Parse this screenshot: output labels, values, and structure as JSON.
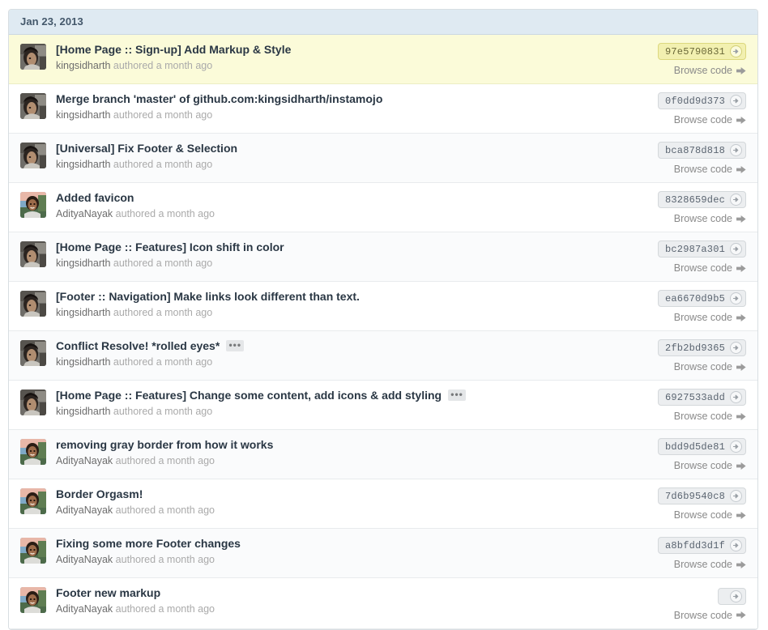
{
  "panel": {
    "date_header": "Jan 23, 2013"
  },
  "labels": {
    "browse_code": "Browse code",
    "authored_suffix": "authored a month ago",
    "expand_ellipsis": "•••"
  },
  "colors": {
    "header_bg": "#dfeaf2",
    "header_text": "#44586b",
    "row_bg": "#fafbfc",
    "row_alt_bg": "#ffffff",
    "highlight_bg": "#fbfbd9",
    "title_text": "#2a3744",
    "meta_text": "#aaaaaa",
    "sha_bg": "#eceef0",
    "sha_text": "#5a6470",
    "link_hover": "#4183c4",
    "border": "#d8dee2"
  },
  "commits": [
    {
      "title": "[Home Page :: Sign-up] Add Markup & Style",
      "author": "kingsidharth",
      "authored": "authored a month ago",
      "sha": "97e5790831",
      "browse": "Browse code",
      "has_expand": false,
      "highlight": true,
      "avatar": "kingsidharth-avatar"
    },
    {
      "title": "Merge branch 'master' of github.com:kingsidharth/instamojo",
      "author": "kingsidharth",
      "authored": "authored a month ago",
      "sha": "0f0dd9d373",
      "browse": "Browse code",
      "has_expand": false,
      "highlight": false,
      "avatar": "kingsidharth-avatar"
    },
    {
      "title": "[Universal] Fix Footer & Selection",
      "author": "kingsidharth",
      "authored": "authored a month ago",
      "sha": "bca878d818",
      "browse": "Browse code",
      "has_expand": false,
      "highlight": false,
      "avatar": "kingsidharth-avatar"
    },
    {
      "title": "Added favicon",
      "author": "AdityaNayak",
      "authored": "authored a month ago",
      "sha": "8328659dec",
      "browse": "Browse code",
      "has_expand": false,
      "highlight": false,
      "avatar": "adityanayak-avatar"
    },
    {
      "title": "[Home Page :: Features] Icon shift in color",
      "author": "kingsidharth",
      "authored": "authored a month ago",
      "sha": "bc2987a301",
      "browse": "Browse code",
      "has_expand": false,
      "highlight": false,
      "avatar": "kingsidharth-avatar"
    },
    {
      "title": "[Footer :: Navigation] Make links look different than text.",
      "author": "kingsidharth",
      "authored": "authored a month ago",
      "sha": "ea6670d9b5",
      "browse": "Browse code",
      "has_expand": false,
      "highlight": false,
      "avatar": "kingsidharth-avatar"
    },
    {
      "title": "Conflict Resolve! *rolled eyes*",
      "author": "kingsidharth",
      "authored": "authored a month ago",
      "sha": "2fb2bd9365",
      "browse": "Browse code",
      "has_expand": true,
      "highlight": false,
      "avatar": "kingsidharth-avatar"
    },
    {
      "title": "[Home Page :: Features] Change some content, add icons & add styling",
      "author": "kingsidharth",
      "authored": "authored a month ago",
      "sha": "6927533add",
      "browse": "Browse code",
      "has_expand": true,
      "highlight": false,
      "avatar": "kingsidharth-avatar"
    },
    {
      "title": "removing gray border from how it works",
      "author": "AdityaNayak",
      "authored": "authored a month ago",
      "sha": "bdd9d5de81",
      "browse": "Browse code",
      "has_expand": false,
      "highlight": false,
      "avatar": "adityanayak-avatar"
    },
    {
      "title": "Border Orgasm!",
      "author": "AdityaNayak",
      "authored": "authored a month ago",
      "sha": "7d6b9540c8",
      "browse": "Browse code",
      "has_expand": false,
      "highlight": false,
      "avatar": "adityanayak-avatar"
    },
    {
      "title": "Fixing some more Footer changes",
      "author": "AdityaNayak",
      "authored": "authored a month ago",
      "sha": "a8bfdd3d1f",
      "browse": "Browse code",
      "has_expand": false,
      "highlight": false,
      "avatar": "adityanayak-avatar"
    },
    {
      "title": "Footer new markup",
      "author": "AdityaNayak",
      "authored": "authored a month ago",
      "sha": "",
      "browse": "Browse code",
      "has_expand": false,
      "highlight": false,
      "avatar": "adityanayak-avatar"
    }
  ]
}
